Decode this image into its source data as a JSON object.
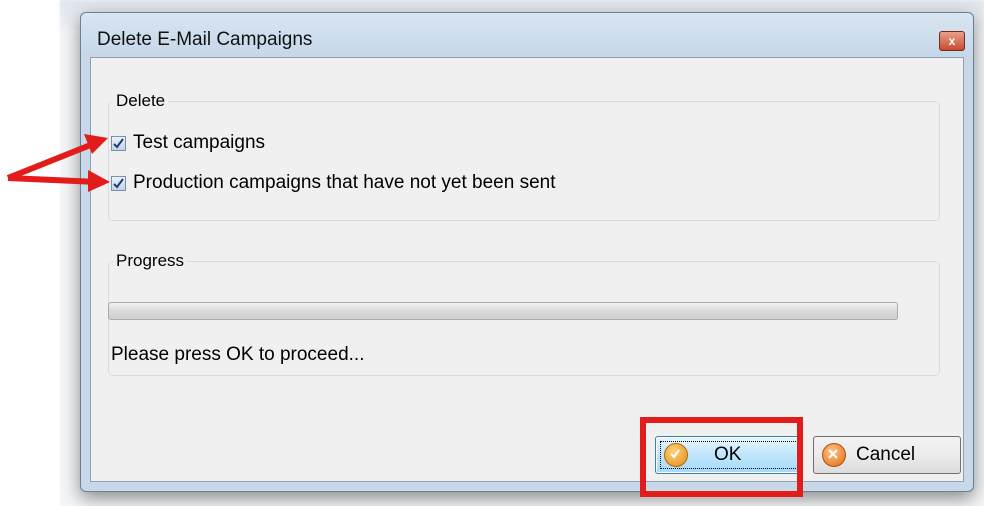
{
  "window": {
    "title": "Delete E-Mail Campaigns",
    "close_glyph": "x"
  },
  "delete_group": {
    "label": "Delete",
    "options": [
      {
        "label": "Test campaigns",
        "checked": true
      },
      {
        "label": "Production campaigns that have not yet been sent",
        "checked": true
      }
    ]
  },
  "progress_group": {
    "label": "Progress",
    "progress_value": 0,
    "status_text": "Please press OK to proceed..."
  },
  "buttons": {
    "ok_label": "OK",
    "cancel_label": "Cancel"
  },
  "annotations": {
    "highlight_color": "#e21b1b",
    "arrow_color": "#e21b1b"
  },
  "icons": {
    "ok": "check-circle-icon",
    "cancel": "x-circle-icon",
    "close": "close-icon"
  }
}
